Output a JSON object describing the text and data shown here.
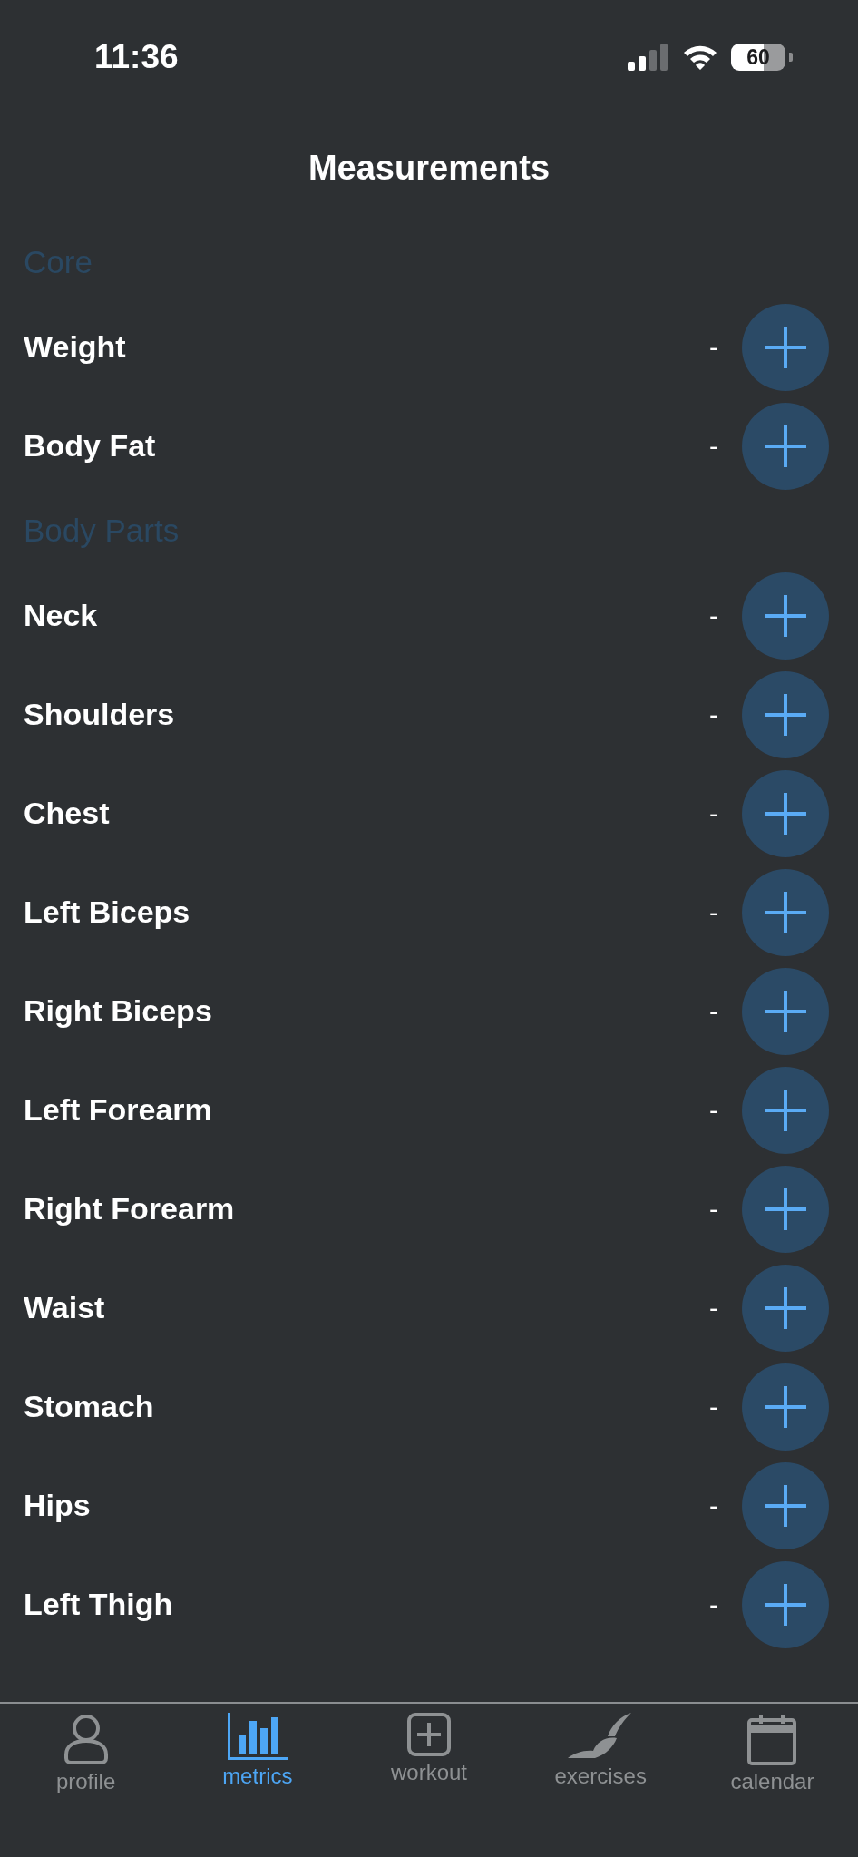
{
  "status_bar": {
    "time": "11:36",
    "battery": "60"
  },
  "title": "Measurements",
  "sections": [
    {
      "header": "Core",
      "rows": [
        {
          "label": "Weight",
          "value": "-"
        },
        {
          "label": "Body Fat",
          "value": "-"
        }
      ]
    },
    {
      "header": "Body Parts",
      "rows": [
        {
          "label": "Neck",
          "value": "-"
        },
        {
          "label": "Shoulders",
          "value": "-"
        },
        {
          "label": "Chest",
          "value": "-"
        },
        {
          "label": "Left Biceps",
          "value": "-"
        },
        {
          "label": "Right Biceps",
          "value": "-"
        },
        {
          "label": "Left Forearm",
          "value": "-"
        },
        {
          "label": "Right Forearm",
          "value": "-"
        },
        {
          "label": "Waist",
          "value": "-"
        },
        {
          "label": "Stomach",
          "value": "-"
        },
        {
          "label": "Hips",
          "value": "-"
        },
        {
          "label": "Left Thigh",
          "value": "-"
        }
      ]
    }
  ],
  "tabs": [
    {
      "label": "profile",
      "kind": "person",
      "selected": false
    },
    {
      "label": "metrics",
      "kind": "chart",
      "selected": true
    },
    {
      "label": "workout",
      "kind": "plus",
      "selected": false
    },
    {
      "label": "exercises",
      "kind": "hat",
      "selected": false
    },
    {
      "label": "calendar",
      "kind": "calendar",
      "selected": false
    }
  ]
}
